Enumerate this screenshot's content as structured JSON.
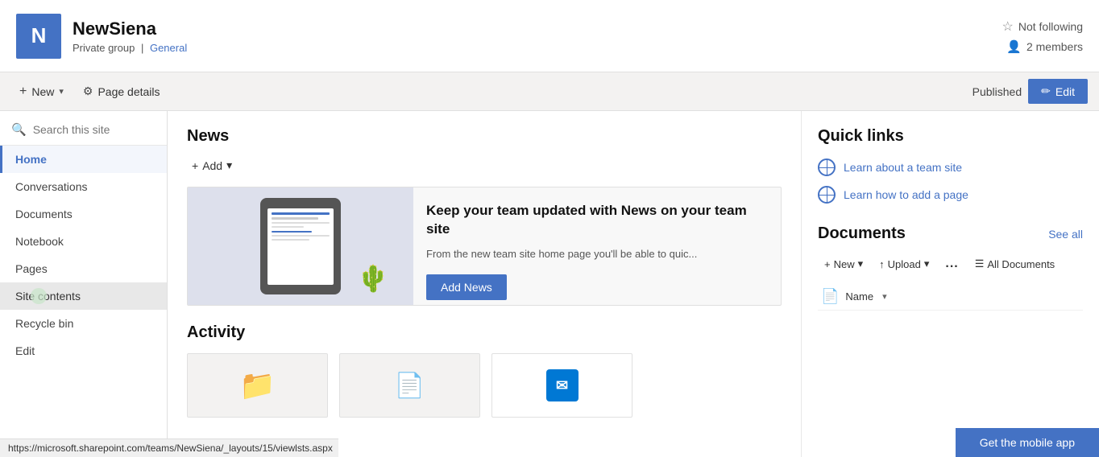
{
  "site": {
    "logo_letter": "N",
    "name": "NewSiena",
    "group_type": "Private group",
    "separator": "|",
    "section": "General"
  },
  "header_right": {
    "not_following_label": "Not following",
    "members_label": "2 members"
  },
  "command_bar": {
    "new_label": "New",
    "page_details_label": "Page details",
    "published_label": "Published",
    "edit_label": "Edit"
  },
  "sidebar": {
    "search_placeholder": "Search this site",
    "items": [
      {
        "label": "Home",
        "active": true
      },
      {
        "label": "Conversations",
        "active": false
      },
      {
        "label": "Documents",
        "active": false
      },
      {
        "label": "Notebook",
        "active": false
      },
      {
        "label": "Pages",
        "active": false
      },
      {
        "label": "Site contents",
        "active": false,
        "hovered": true
      },
      {
        "label": "Recycle bin",
        "active": false
      },
      {
        "label": "Edit",
        "active": false
      }
    ]
  },
  "news": {
    "title": "News",
    "add_label": "Add",
    "headline": "Keep your team updated with News on your team site",
    "subtext": "From the new team site home page you'll be able to quic...",
    "add_news_label": "Add News"
  },
  "activity": {
    "title": "Activity"
  },
  "quick_links": {
    "title": "Quick links",
    "items": [
      {
        "label": "Learn about a team site"
      },
      {
        "label": "Learn how to add a page"
      }
    ]
  },
  "documents": {
    "title": "Documents",
    "see_all_label": "See all",
    "toolbar": {
      "new_label": "New",
      "upload_label": "Upload",
      "ellipsis_label": "...",
      "all_docs_label": "All Documents"
    },
    "name_col_label": "Name"
  },
  "mobile_app": {
    "label": "Get the mobile app"
  },
  "status_bar": {
    "url": "https://microsoft.sharepoint.com/teams/NewSiena/_layouts/15/viewlsts.aspx"
  }
}
